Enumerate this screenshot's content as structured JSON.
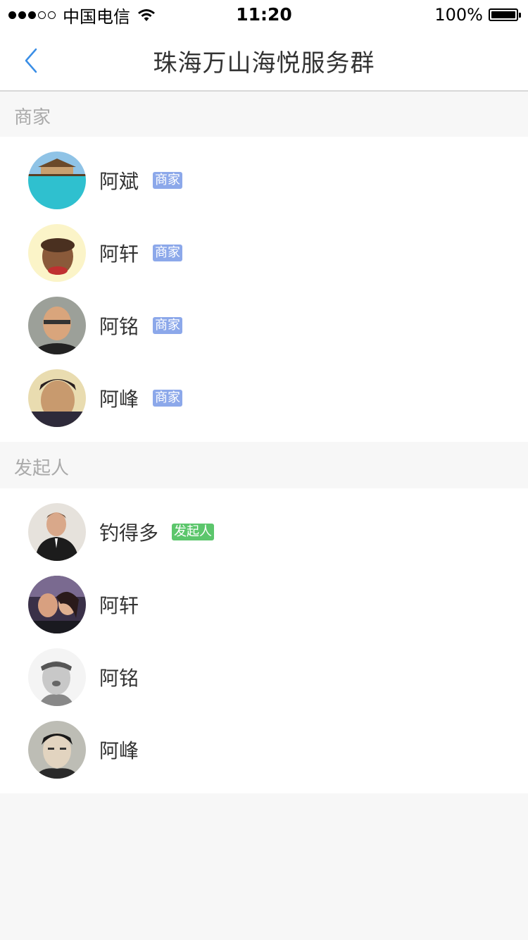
{
  "status_bar": {
    "carrier": "中国电信",
    "time": "11:20",
    "battery": "100%"
  },
  "nav": {
    "title": "珠海万山海悦服务群",
    "back_icon": "chevron-left-icon"
  },
  "colors": {
    "accent": "#3a8ee6",
    "merchant_tag": "#8ca8ea",
    "founder_tag": "#5cc66c"
  },
  "sections": [
    {
      "title": "商家",
      "members": [
        {
          "name": "阿斌",
          "tag": "商家"
        },
        {
          "name": "阿轩",
          "tag": "商家"
        },
        {
          "name": "阿铭",
          "tag": "商家"
        },
        {
          "name": "阿峰",
          "tag": "商家"
        }
      ]
    },
    {
      "title": "发起人",
      "members": [
        {
          "name": "钓得多",
          "tag": "发起人"
        },
        {
          "name": "阿轩",
          "tag": ""
        },
        {
          "name": "阿铭",
          "tag": ""
        },
        {
          "name": "阿峰",
          "tag": ""
        }
      ]
    }
  ]
}
